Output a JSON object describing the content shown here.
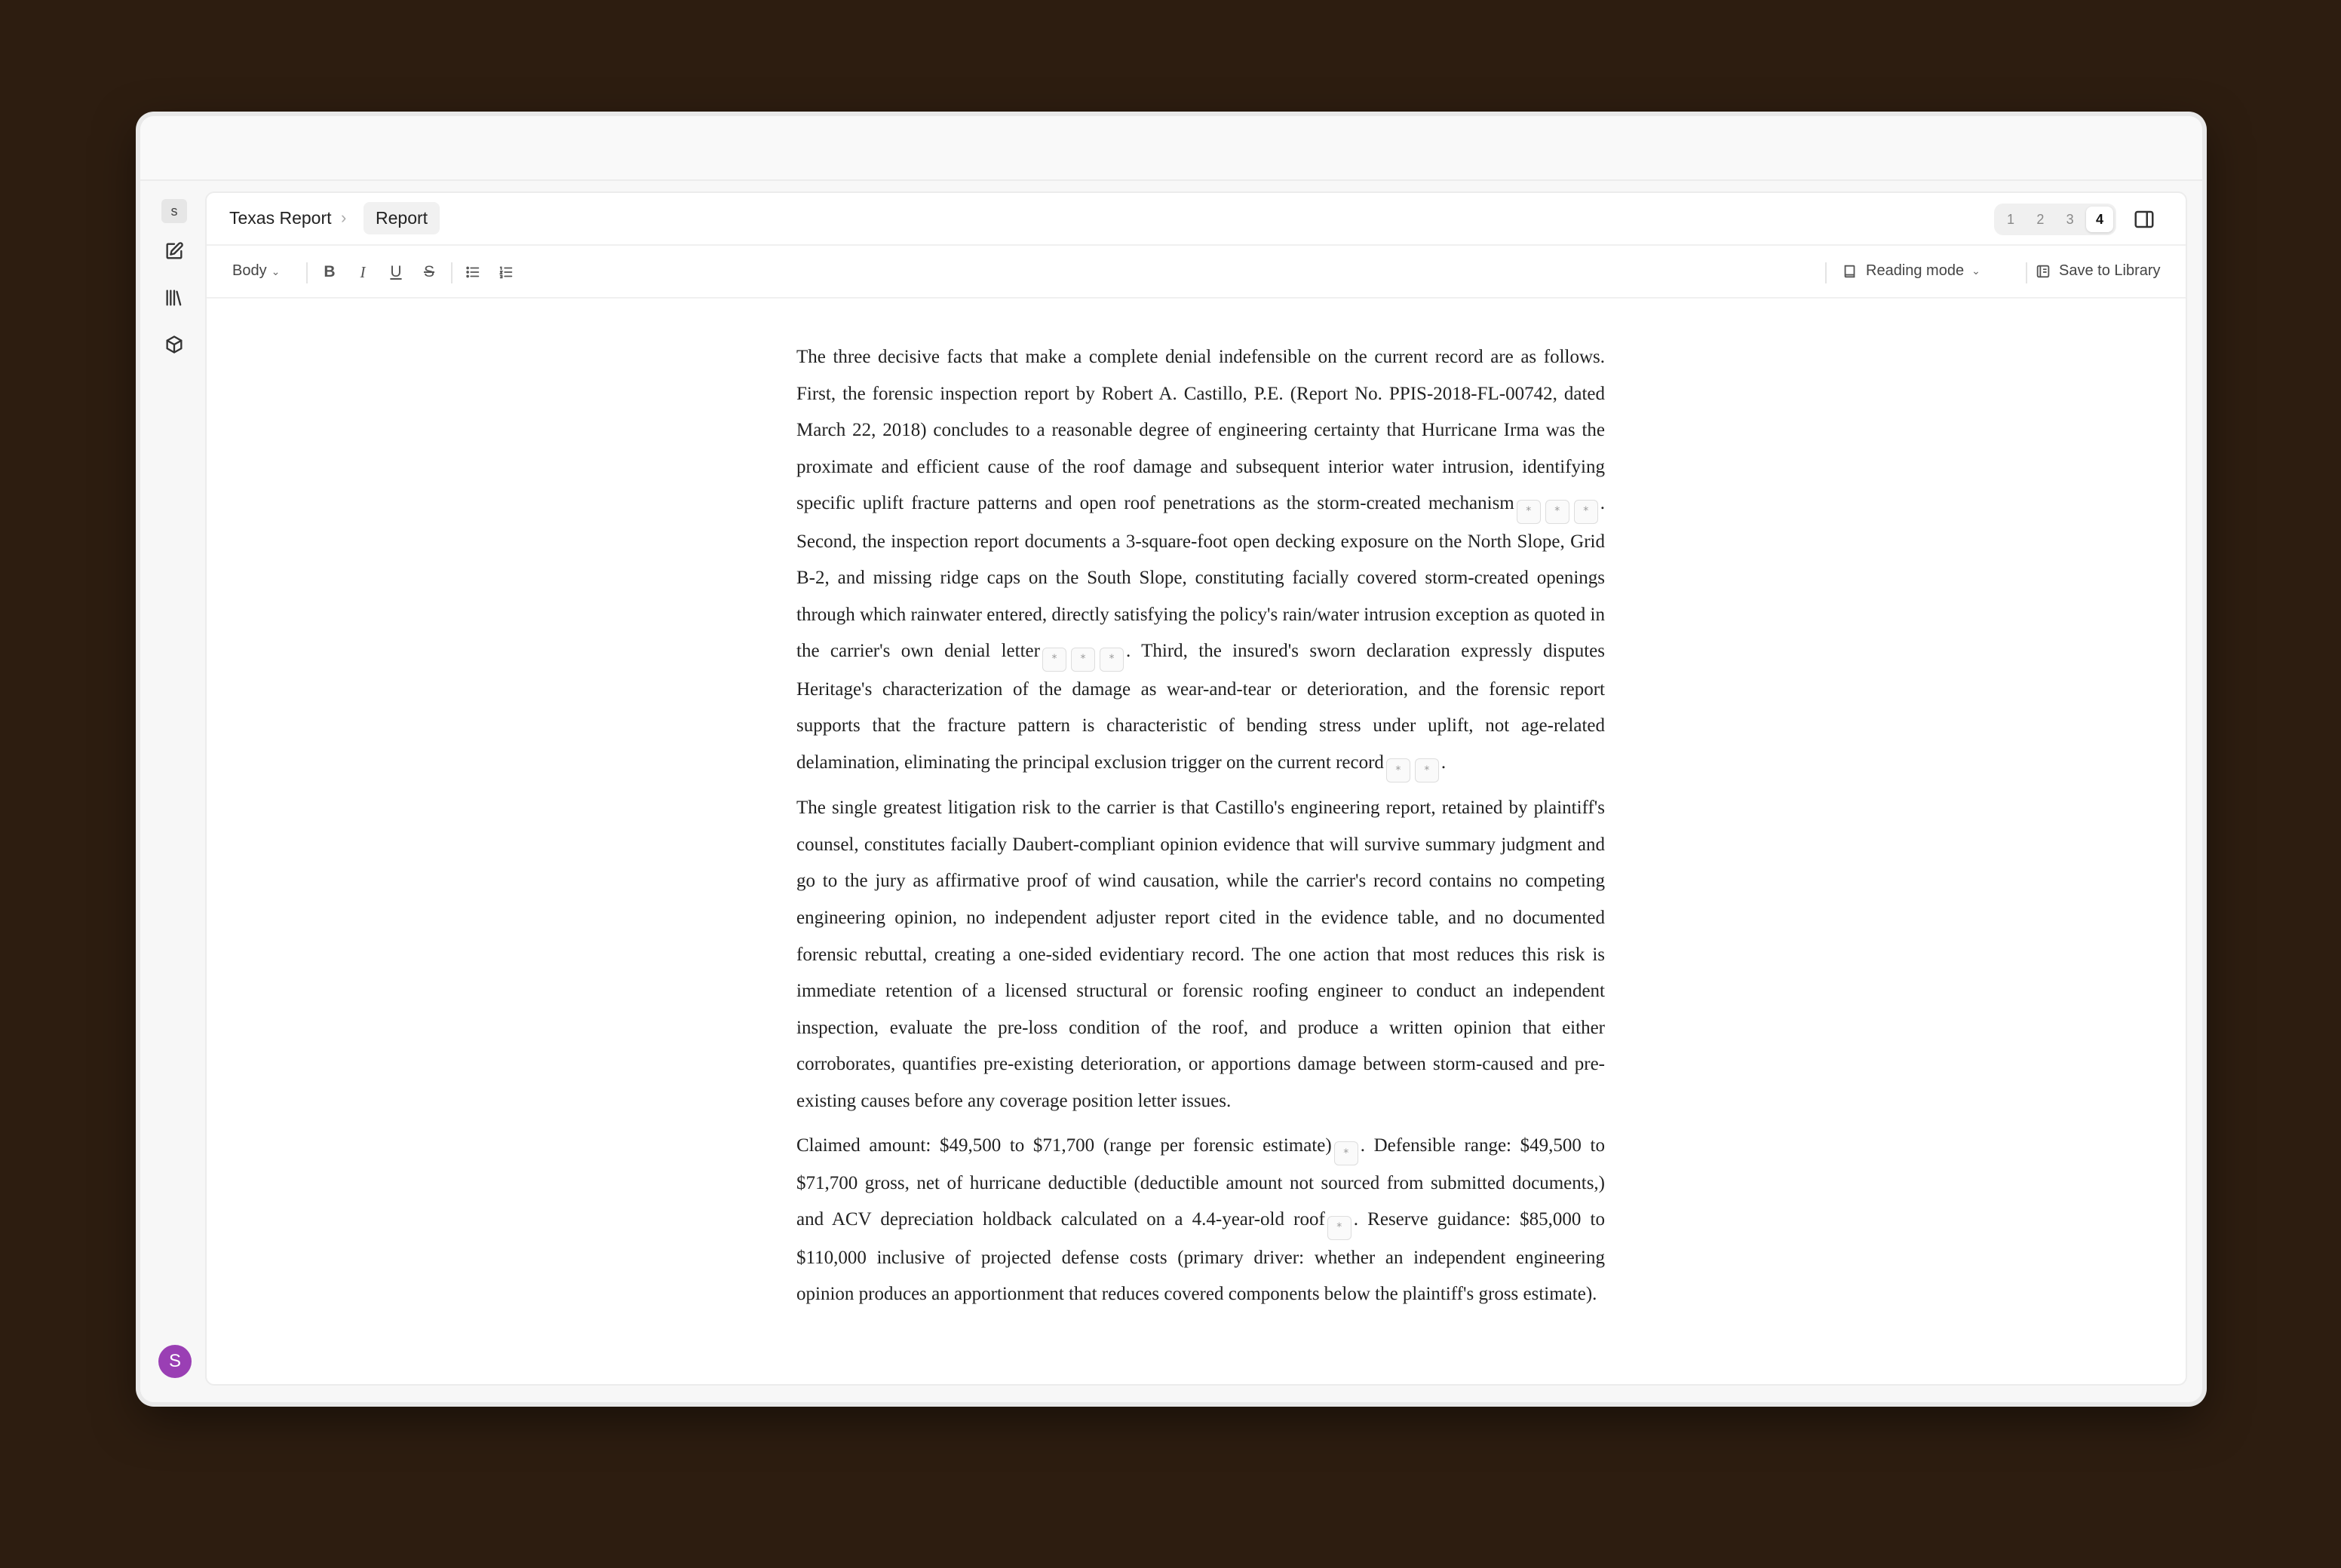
{
  "breadcrumb": {
    "root": "Texas Report",
    "separator": "›",
    "current": "Report"
  },
  "workspace_badge": "s",
  "user_avatar": "S",
  "pager": {
    "pages": [
      "1",
      "2",
      "3",
      "4"
    ],
    "active": "4"
  },
  "toolbar": {
    "style_select": "Body",
    "bold": "B",
    "italic": "I",
    "underline": "U",
    "strike": "S",
    "reading_mode": "Reading mode",
    "save_to_library": "Save to Library"
  },
  "citation_marker": "*",
  "document": {
    "p1": [
      "The three decisive facts that make a complete denial indefensible on the current record are as follows. First, the forensic inspection report by Robert A. Castillo, P.E. (Report No. PPIS-2018-FL-00742, dated March 22, 2018) concludes to a reasonable degree of engineering certainty that Hurricane Irma was the proximate and efficient cause of the roof damage and subsequent interior water intrusion, identifying specific uplift fracture patterns and open roof penetrations as the storm-created mechanism",
      ". Second, the inspection report documents a 3-square-foot open decking exposure on the North Slope, Grid B-2, and missing ridge caps on the South Slope, constituting facially covered storm-created openings through which rainwater entered, directly satisfying the policy's rain/water intrusion exception as quoted in the carrier's own denial letter",
      ". Third, the insured's sworn declaration expressly disputes Heritage's characterization of the damage as wear-and-tear or deterioration, and the forensic report supports that the fracture pattern is characteristic of bending stress under uplift, not age-related delamination, eliminating the principal exclusion trigger on the current record",
      "."
    ],
    "p2": "The single greatest litigation risk to the carrier is that Castillo's engineering report, retained by plaintiff's counsel, constitutes facially Daubert-compliant opinion evidence that will survive summary judgment and go to the jury as affirmative proof of wind causation, while the carrier's record contains no competing engineering opinion, no independent adjuster report cited in the evidence table, and no documented forensic rebuttal, creating a one-sided evidentiary record. The one action that most reduces this risk is immediate retention of a licensed structural or forensic roofing engineer to conduct an independent inspection, evaluate the pre-loss condition of the roof, and produce a written opinion that either corroborates, quantifies pre-existing deterioration, or apportions damage between storm-caused and pre-existing causes before any coverage position letter issues.",
    "p3": [
      "Claimed amount: $49,500 to $71,700 (range per forensic estimate)",
      ". Defensible range: $49,500 to $71,700 gross, net of hurricane deductible (deductible amount not sourced from submitted documents,) and ACV depreciation holdback calculated on a 4.4-year-old roof",
      ". Reserve guidance: $85,000 to $110,000 inclusive of projected defense costs (primary driver: whether an independent engineering opinion produces an apportionment that reduces covered components below the plaintiff's gross estimate)."
    ]
  }
}
